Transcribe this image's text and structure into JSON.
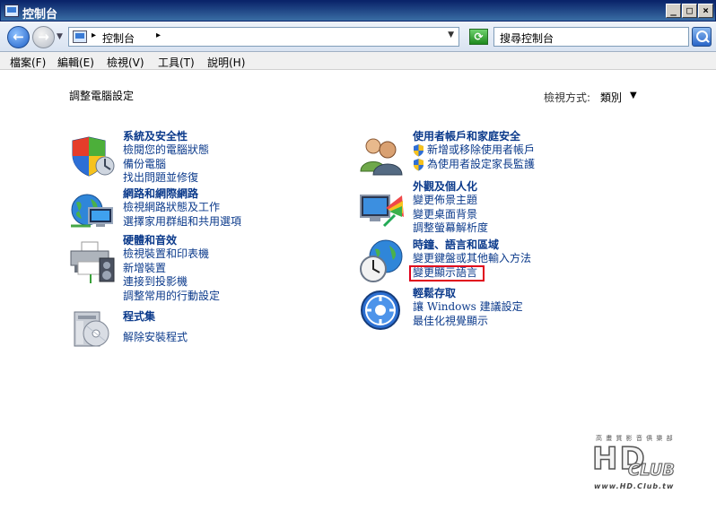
{
  "window": {
    "title": "控制台"
  },
  "address": {
    "crumb": "控制台",
    "search_placeholder": "搜尋控制台"
  },
  "menu": [
    "檔案(F)",
    "編輯(E)",
    "檢視(V)",
    "工具(T)",
    "說明(H)"
  ],
  "page": {
    "title": "調整電腦設定",
    "view_by_label": "檢視方式:",
    "view_by_value": "類別"
  },
  "categories_left": [
    {
      "title": "系統及安全性",
      "links": [
        "檢閱您的電腦狀態",
        "備份電腦",
        "找出問題並修復"
      ],
      "icon": "shield-icon"
    },
    {
      "title": "網路和網際網路",
      "links": [
        "檢視網路狀態及工作",
        "選擇家用群組和共用選項"
      ],
      "icon": "network-globe-icon"
    },
    {
      "title": "硬體和音效",
      "links": [
        "檢視裝置和印表機",
        "新增裝置",
        "連接到投影機",
        "調整常用的行動設定"
      ],
      "icon": "printer-icon"
    },
    {
      "title": "程式集",
      "links": [
        "解除安裝程式"
      ],
      "icon": "programs-icon"
    }
  ],
  "categories_right": [
    {
      "title": "使用者帳戶和家庭安全",
      "links": [
        "新增或移除使用者帳戶",
        "為使用者設定家長監護"
      ],
      "icon": "users-icon"
    },
    {
      "title": "外觀及個人化",
      "links": [
        "變更佈景主題",
        "變更桌面背景",
        "調整螢幕解析度"
      ],
      "icon": "monitor-palette-icon"
    },
    {
      "title": "時鐘、語言和區域",
      "links": [
        "變更鍵盤或其他輸入方法",
        "變更顯示語言"
      ],
      "icon": "clock-globe-icon"
    },
    {
      "title": "輕鬆存取",
      "links": [
        "讓 Windows 建議設定",
        "最佳化視覺顯示"
      ],
      "icon": "ease-of-access-icon"
    }
  ],
  "watermark": {
    "line1": "HD",
    "line2": "CLUB",
    "url": "www.HD.Club.tw",
    "top": "高 畫 質 影 音 俱 樂 部"
  },
  "colors": {
    "link": "#0b3a8b",
    "highlight": "#e0001b",
    "titlebar": "#0a246a"
  }
}
